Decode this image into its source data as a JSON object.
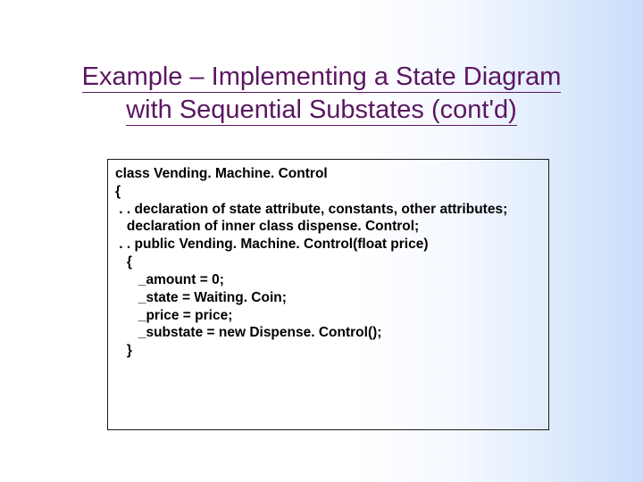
{
  "title": {
    "line1": "Example – Implementing a State Diagram",
    "line2": "with Sequential Substates (cont'd)"
  },
  "code": {
    "l0": "class Vending. Machine. Control",
    "l1": "{",
    "l2": " . . declaration of state attribute, constants, other attributes;",
    "l3": "   declaration of inner class dispense. Control;",
    "l4": " . . public Vending. Machine. Control(float price)",
    "l5": "   {",
    "l6": "      _amount = 0;",
    "l7": "      _state = Waiting. Coin;",
    "l8": "      _price = price;",
    "l9": "      _substate = new Dispense. Control();",
    "l10": "   }"
  }
}
